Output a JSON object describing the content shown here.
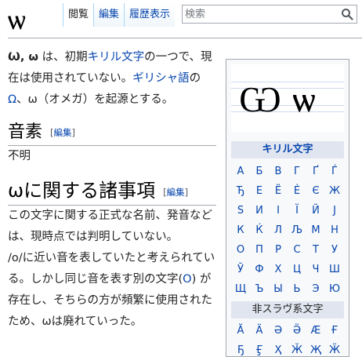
{
  "title": "ѡ",
  "tabs": [
    {
      "label": "閲覧",
      "selected": true
    },
    {
      "label": "編集",
      "selected": false
    },
    {
      "label": "履歴表示",
      "selected": false
    }
  ],
  "search": {
    "placeholder": "検索",
    "icon": "magnifier"
  },
  "intro": {
    "lead": "Ѡ, ѡ",
    "t1": " は、初期",
    "link1": "キリル文字",
    "t2": "の一つで、現在は使用されていない。",
    "link2": "ギリシャ語",
    "t3": "の",
    "link3": "Ω",
    "t4": "、ω（オメガ）を起源とする。"
  },
  "sections": [
    {
      "heading": "音素",
      "edit": "編集",
      "text": "不明"
    },
    {
      "heading": "ѡに関する諸事項",
      "edit": "編集",
      "p1": "この文字に関する正式な名前、発音などは、現時点では判明していない。",
      "p2": {
        "a": "/o/に近い音を表していたと考えられている。しかし同じ音を表す別の文字(",
        "link": "О",
        "b": ") が存在し、そちらの方が頻繁に使用されたため、ѡは廃れていった。"
      }
    }
  ],
  "infobox": {
    "glyph": "Ѡ ѡ",
    "cyrillic_header": "キリル文字",
    "cyrillic_letters": [
      "А",
      "Б",
      "В",
      "Г",
      "Ґ",
      "Ѓ",
      "Ђ",
      "Е",
      "Ё",
      "Ѐ",
      "Є",
      "Ж",
      "Ѕ",
      "И",
      "І",
      "Ї",
      "Й",
      "Ј",
      "К",
      "Ќ",
      "Л",
      "Љ",
      "М",
      "Н",
      "О",
      "П",
      "Р",
      "С",
      "Т",
      "У",
      "Ў",
      "Ф",
      "Х",
      "Ц",
      "Ч",
      "Ш",
      "Щ",
      "Ъ",
      "Ы",
      "Ь",
      "Э",
      "Ю"
    ],
    "non_slavic_header": "非スラヴ系文字",
    "non_slavic_letters": [
      "Ӑ",
      "Ӓ",
      "Ә",
      "Ӛ",
      "Ӕ",
      "Ғ",
      "Ҕ",
      "Ӻ",
      "Ҳ",
      "Ӂ",
      "Җ",
      "Ӝ"
    ]
  },
  "colors": {
    "link": "#0645ad",
    "border": "#a2a9b1",
    "tab_border": "#a7d7f9",
    "infobox_bg": "#f8f9fa",
    "infobox_header_bg": "#e0e5f0"
  }
}
